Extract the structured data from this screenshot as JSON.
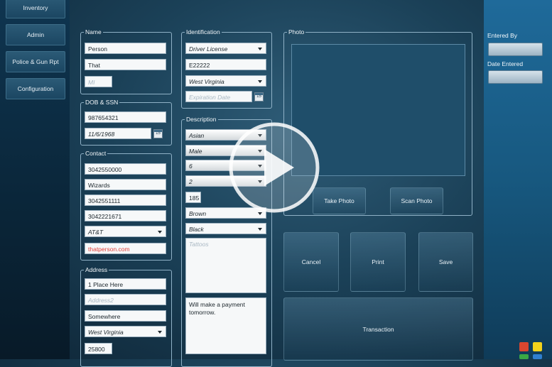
{
  "nav": {
    "inventory": "Inventory",
    "admin": "Admin",
    "police": "Police & Gun Rpt",
    "configuration": "Configuration"
  },
  "name_group": {
    "legend": "Name",
    "first": "Person",
    "last": "That",
    "mi_placeholder": "MI"
  },
  "dob_group": {
    "legend": "DOB & SSN",
    "ssn": "987654321",
    "dob": "11/6/1968",
    "cal": "15"
  },
  "contact_group": {
    "legend": "Contact",
    "phone1": "3042550000",
    "employer": "Wizards",
    "phone2": "3042551111",
    "phone3": "3042221671",
    "carrier": "AT&T",
    "email": "thatperson.com"
  },
  "address_group": {
    "legend": "Address",
    "line1": "1 Place Here",
    "line2_placeholder": "Address2",
    "city": "Somewhere",
    "state": "West Virginia",
    "zip": "25800"
  },
  "id_group": {
    "legend": "Identification",
    "type": "Driver License",
    "number": "E22222",
    "state": "West Virginia",
    "exp_placeholder": "Expiration Date",
    "cal": "15"
  },
  "desc_group": {
    "legend": "Description",
    "race": "Asian",
    "sex": "Male",
    "height_ft": "6",
    "height_in": "2",
    "weight": "185",
    "eyes": "Brown",
    "hair": "Black",
    "tattoos_placeholder": "Tattoos",
    "notes": "Will make a payment tomorrow."
  },
  "photo_group": {
    "legend": "Photo",
    "take": "Take Photo",
    "scan": "Scan Photo"
  },
  "actions": {
    "cancel": "Cancel",
    "print": "Print",
    "save": "Save",
    "transaction": "Transaction"
  },
  "right": {
    "entered_by": "Entered By",
    "date_entered": "Date Entered"
  },
  "colors": {
    "accent": "#1f6a9a",
    "email_red": "#e2413a"
  }
}
